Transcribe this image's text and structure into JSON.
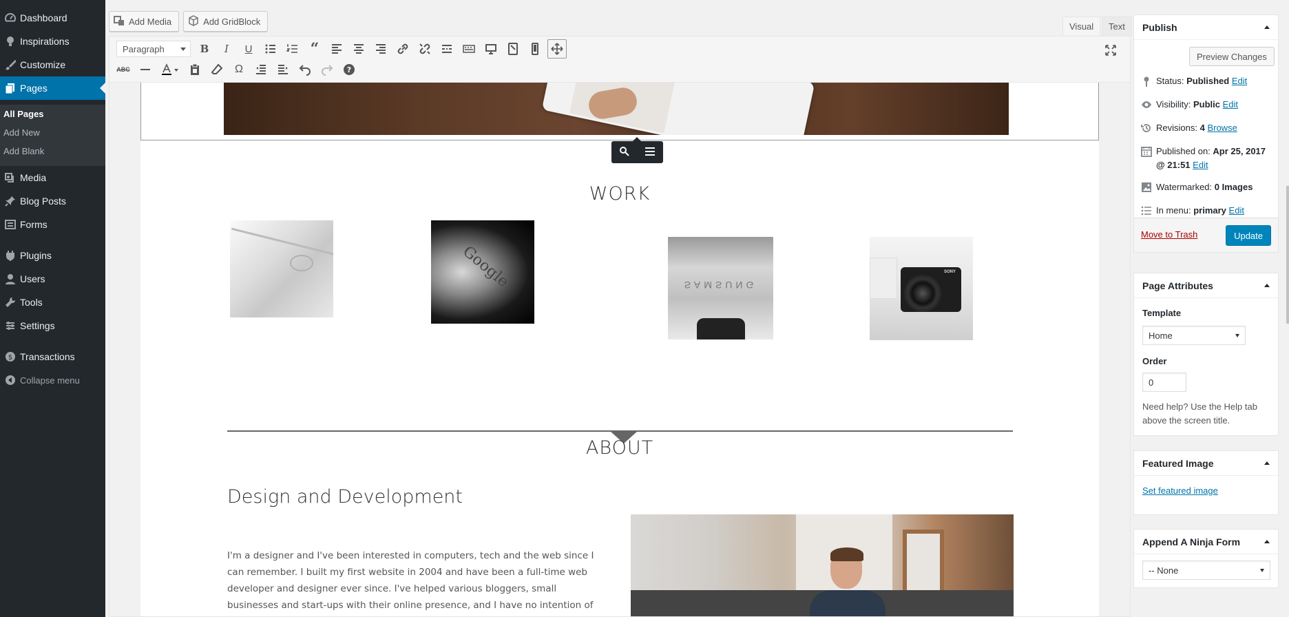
{
  "admin_menu": {
    "items": [
      {
        "label": "Dashboard",
        "icon": "dashboard-icon"
      },
      {
        "label": "Inspirations",
        "icon": "lightbulb-icon"
      },
      {
        "label": "Customize",
        "icon": "paintbrush-icon"
      },
      {
        "label": "Pages",
        "icon": "pages-icon"
      },
      {
        "label": "Media",
        "icon": "media-icon"
      },
      {
        "label": "Blog Posts",
        "icon": "pushpin-icon"
      },
      {
        "label": "Forms",
        "icon": "forms-icon"
      },
      {
        "label": "Plugins",
        "icon": "plugin-icon"
      },
      {
        "label": "Users",
        "icon": "users-icon"
      },
      {
        "label": "Tools",
        "icon": "wrench-icon"
      },
      {
        "label": "Settings",
        "icon": "settings-icon"
      },
      {
        "label": "Transactions",
        "icon": "money-icon"
      },
      {
        "label": "Collapse menu",
        "icon": "collapse-icon"
      }
    ],
    "submenu": [
      "All Pages",
      "Add New",
      "Add Blank"
    ],
    "current": "Pages",
    "current_sub": "All Pages"
  },
  "editor": {
    "add_media": "Add Media",
    "add_gridblock": "Add GridBlock",
    "tab_visual": "Visual",
    "tab_text": "Text",
    "active_tab": "Visual",
    "format_select": "Paragraph"
  },
  "content": {
    "work_title": "WORK",
    "work_image_text_1": "Google",
    "work_image_text_2": "SAMSUNG",
    "camera_brand": "SONY",
    "about_title": "ABOUT",
    "about_heading": "Design and Development",
    "about_paragraph": "I'm a designer and I've been interested in computers, tech and the web since I can remember. I built my first website in 2004 and have been a full-time web developer and designer ever since. I've helped various bloggers, small businesses and start-ups with their online presence, and I have no intention of slowing down!"
  },
  "publish": {
    "title": "Publish",
    "preview_button": "Preview Changes",
    "status_label": "Status:",
    "status_value": "Published",
    "visibility_label": "Visibility:",
    "visibility_value": "Public",
    "revisions_label": "Revisions:",
    "revisions_value": "4",
    "browse_link": "Browse",
    "published_label": "Published on:",
    "published_value": "Apr 25, 2017 @ 21:51",
    "watermark_label": "Watermarked:",
    "watermark_value": "0 Images",
    "menu_label": "In menu:",
    "menu_value": "primary",
    "edit_link": "Edit",
    "trash_link": "Move to Trash",
    "update_button": "Update"
  },
  "page_attributes": {
    "title": "Page Attributes",
    "template_label": "Template",
    "template_value": "Home",
    "order_label": "Order",
    "order_value": "0",
    "help_text": "Need help? Use the Help tab above the screen title."
  },
  "featured_image": {
    "title": "Featured Image",
    "set_link": "Set featured image"
  },
  "ninja_form": {
    "title": "Append A Ninja Form",
    "select_value": "-- None"
  },
  "colors": {
    "admin_bg": "#23282d",
    "accent": "#0073aa",
    "primary_button": "#0085ba",
    "trash_link": "#a00"
  }
}
